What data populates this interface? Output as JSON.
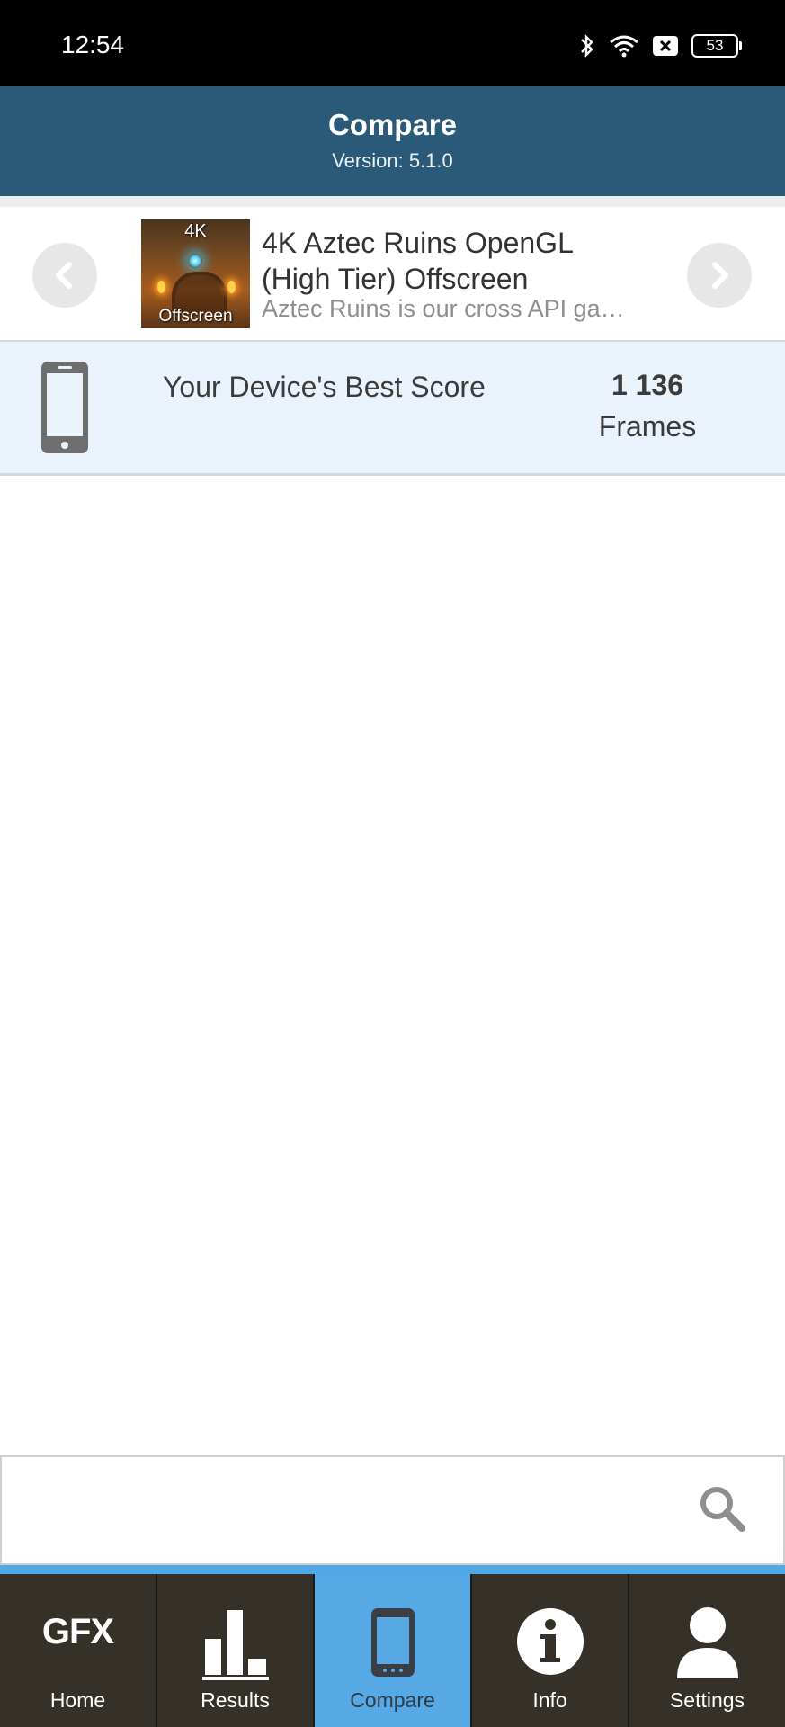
{
  "status_bar": {
    "time": "12:54",
    "battery": "53"
  },
  "header": {
    "title": "Compare",
    "version": "Version: 5.1.0"
  },
  "test": {
    "thumbnail_top": "4K",
    "thumbnail_bottom": "Offscreen",
    "title": "4K Aztec Ruins OpenGL (High Tier) Offscreen",
    "description": "Aztec Ruins is our cross API ga…"
  },
  "best_score": {
    "label": "Your Device's Best Score",
    "value": "1 136",
    "unit": "Frames"
  },
  "search": {
    "value": "",
    "placeholder": ""
  },
  "tabs": [
    {
      "label": "Home",
      "icon": "gfx-logo",
      "logo_text": "GFX",
      "active": false
    },
    {
      "label": "Results",
      "icon": "bar-chart-icon",
      "active": false
    },
    {
      "label": "Compare",
      "icon": "phone-icon",
      "active": true
    },
    {
      "label": "Info",
      "icon": "info-icon",
      "active": false
    },
    {
      "label": "Settings",
      "icon": "user-icon",
      "active": false
    }
  ],
  "colors": {
    "header": "#2b5a79",
    "active_tab": "#56a9e5",
    "tab_bar": "#353128",
    "score_row": "#eaf3fc"
  }
}
